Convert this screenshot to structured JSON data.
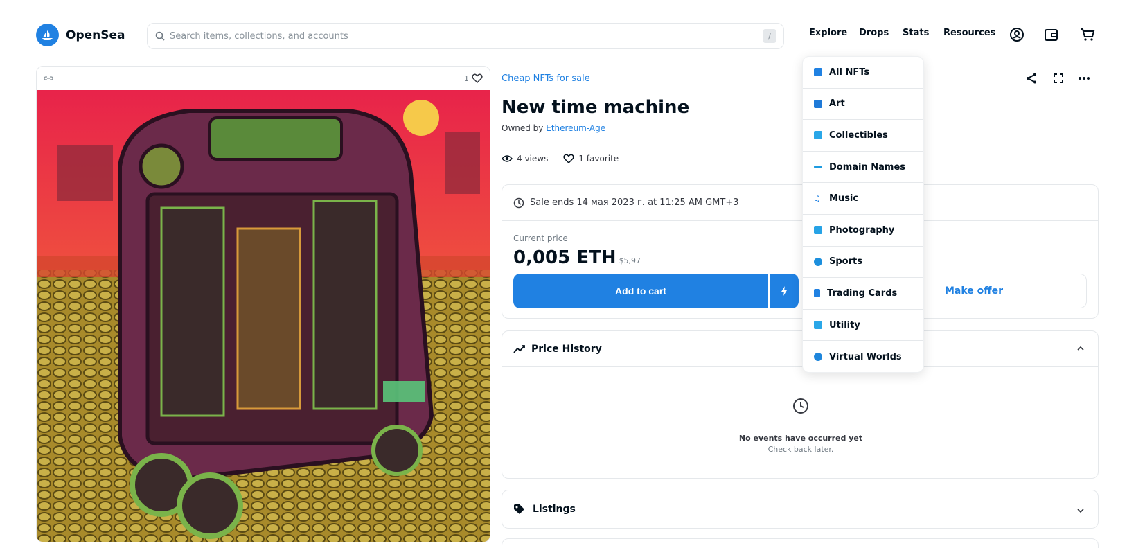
{
  "header": {
    "logo_text": "OpenSea",
    "search_placeholder": "Search items, collections, and accounts",
    "search_shortcut": "/",
    "nav": [
      "Explore",
      "Drops",
      "Stats",
      "Resources"
    ],
    "icons": [
      "account-icon",
      "wallet-icon",
      "cart-icon"
    ]
  },
  "image_card": {
    "chain_icon": "link-icon",
    "favorites_count": "1"
  },
  "item": {
    "collection": "Cheap NFTs for sale",
    "title": "New time machine",
    "owned_by_label": "Owned by",
    "owner": "Ethereum-Age",
    "views": "4 views",
    "favorites": "1 favorite"
  },
  "sale": {
    "ends_text": "Sale ends 14 мая 2023 г. at 11:25 AM GMT+3",
    "current_price_label": "Current price",
    "price": "0,005 ETH",
    "price_usd": "$5,97",
    "add_to_cart": "Add to cart",
    "make_offer": "Make offer"
  },
  "price_history": {
    "title": "Price History",
    "empty_title": "No events have occurred yet",
    "empty_subtitle": "Check back later."
  },
  "listings": {
    "title": "Listings"
  },
  "explore_menu": {
    "items": [
      {
        "label": "All NFTs",
        "color": "#2081e2"
      },
      {
        "label": "Art",
        "color": "#1f7ad8"
      },
      {
        "label": "Collectibles",
        "color": "#2aa7e8"
      },
      {
        "label": "Domain Names",
        "color": "#1e9be0"
      },
      {
        "label": "Music",
        "color": "#2081e2"
      },
      {
        "label": "Photography",
        "color": "#27a3e6"
      },
      {
        "label": "Sports",
        "color": "#1c8fdd"
      },
      {
        "label": "Trading Cards",
        "color": "#2081e2"
      },
      {
        "label": "Utility",
        "color": "#2aa7e8"
      },
      {
        "label": "Virtual Worlds",
        "color": "#1e86dc"
      }
    ]
  },
  "colors": {
    "accent": "#2081e2",
    "border": "#e5e8eb",
    "text": "#04111d"
  }
}
